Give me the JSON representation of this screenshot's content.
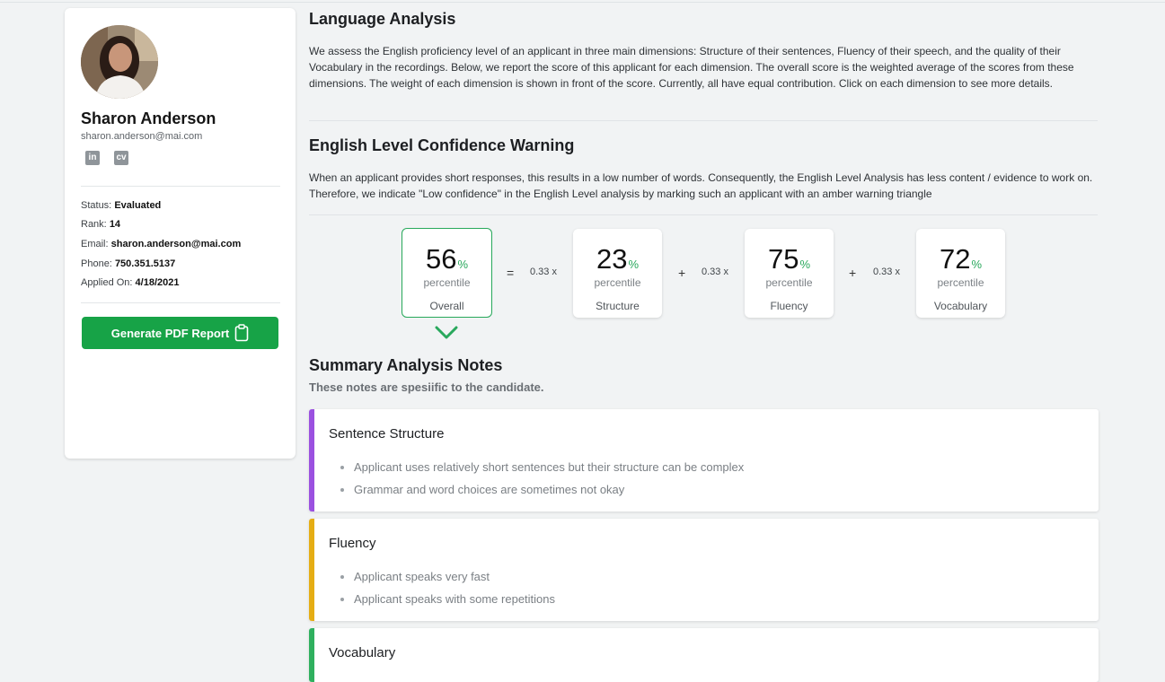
{
  "profile": {
    "name": "Sharon Anderson",
    "email_sub": "sharon.anderson@mai.com",
    "social": {
      "linkedin_label": "in",
      "cv_label": "cv"
    },
    "details": [
      {
        "label": "Status:",
        "value": "Evaluated"
      },
      {
        "label": "Rank:",
        "value": "14"
      },
      {
        "label": "Email:",
        "value": "sharon.anderson@mai.com"
      },
      {
        "label": "Phone:",
        "value": "750.351.5137"
      },
      {
        "label": "Applied On:",
        "value": "4/18/2021"
      }
    ],
    "generate_button": "Generate PDF Report"
  },
  "language_analysis": {
    "title": "Language Analysis",
    "description": "We assess the English proficiency level of an applicant in three main dimensions: Structure of their sentences, Fluency of their speech, and the quality of their Vocabulary in the recordings. Below, we report the score of this applicant for each dimension. The overall score is the weighted average of the scores from these dimensions. The weight of each dimension is shown in front of the score. Currently, all have equal contribution. Click on each dimension to see more details."
  },
  "warning": {
    "title": "English Level Confidence Warning",
    "description": "When an applicant provides short responses, this results in a low number of words. Consequently, the English Level Analysis has less content / evidence to work on. Therefore, we indicate \"Low confidence\" in the English Level analysis by marking such an applicant with an amber warning triangle"
  },
  "scores": {
    "unit": "%",
    "sub": "percentile",
    "overall": {
      "value": "56",
      "label": "Overall"
    },
    "structure": {
      "value": "23",
      "label": "Structure",
      "weight": "0.33 x"
    },
    "fluency": {
      "value": "75",
      "label": "Fluency",
      "weight": "0.33 x"
    },
    "vocabulary": {
      "value": "72",
      "label": "Vocabulary",
      "weight": "0.33 x"
    },
    "ops": {
      "equals": "=",
      "plus": "+"
    }
  },
  "summary": {
    "title": "Summary Analysis Notes",
    "subtitle": "These notes are spesiific to the candidate.",
    "notes": [
      {
        "title": "Sentence Structure",
        "color": "#9b51e0",
        "items": [
          "Applicant uses relatively short sentences but their structure can be complex",
          "Grammar and word choices are sometimes not okay"
        ]
      },
      {
        "title": "Fluency",
        "color": "#e5ad14",
        "items": [
          "Applicant speaks very fast",
          "Applicant speaks with some repetitions"
        ]
      },
      {
        "title": "Vocabulary",
        "color": "#2fb05e",
        "items": []
      }
    ]
  },
  "colors": {
    "accent_green": "#17a347",
    "percent_green": "#29a85c",
    "page_bg": "#f1f3f4"
  }
}
